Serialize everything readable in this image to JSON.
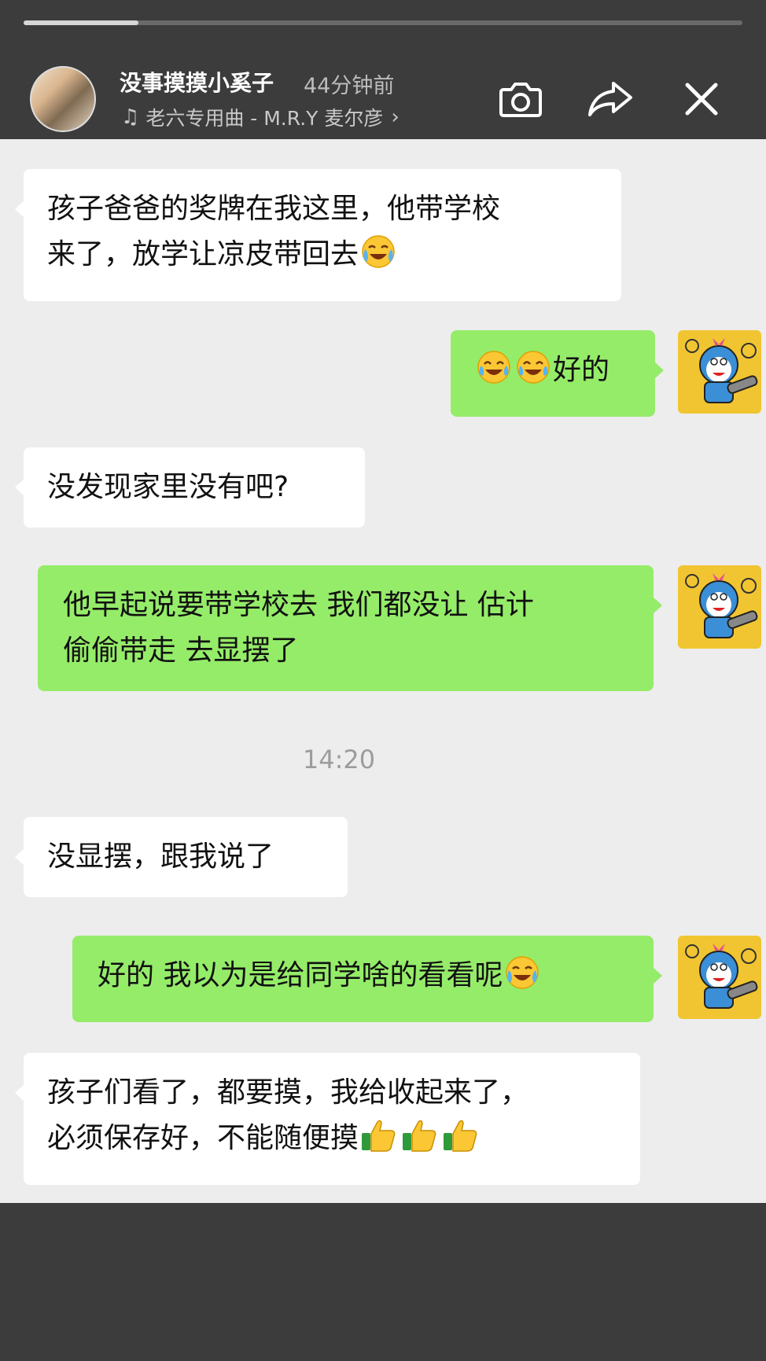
{
  "story": {
    "progress": 0.16
  },
  "header": {
    "username": "没事摸摸小奚子",
    "time": "44分钟前",
    "music": "老六专用曲 - M.R.Y 麦尔彦",
    "camera_icon": "camera-icon",
    "share_icon": "share-arrow-icon",
    "close_icon": "close-icon"
  },
  "chat": {
    "messages": [
      {
        "side": "in",
        "line1": "孩子爸爸的奖牌在我这里，他带学校",
        "line2": "来了，放学让凉皮带回去",
        "emoji": "crying-laughing-emoji"
      },
      {
        "side": "out",
        "text": "好的",
        "emoji": "tears-of-joy-emoji"
      },
      {
        "side": "in",
        "text": "没发现家里没有吧?"
      },
      {
        "side": "out",
        "line1": "他早起说要带学校去 我们都没让 估计",
        "line2": "偷偷带走 去显摆了"
      },
      {
        "side": "in",
        "text": "没显摆，跟我说了"
      },
      {
        "side": "out",
        "text": "好的 我以为是给同学啥的看看呢",
        "emoji": "crying-laughing-emoji"
      },
      {
        "side": "in",
        "line1": "孩子们看了，都要摸，我给收起来了，",
        "line2": "必须保存好，不能随便摸",
        "emoji": "thumbs-up-emoji"
      }
    ],
    "timestamp": "14:20",
    "avatar": "cartoon-avatar"
  },
  "colors": {
    "outgoing": "#95ec69",
    "incoming": "#ffffff",
    "chat_bg": "#ededed",
    "frame": "#3c3c3c"
  }
}
